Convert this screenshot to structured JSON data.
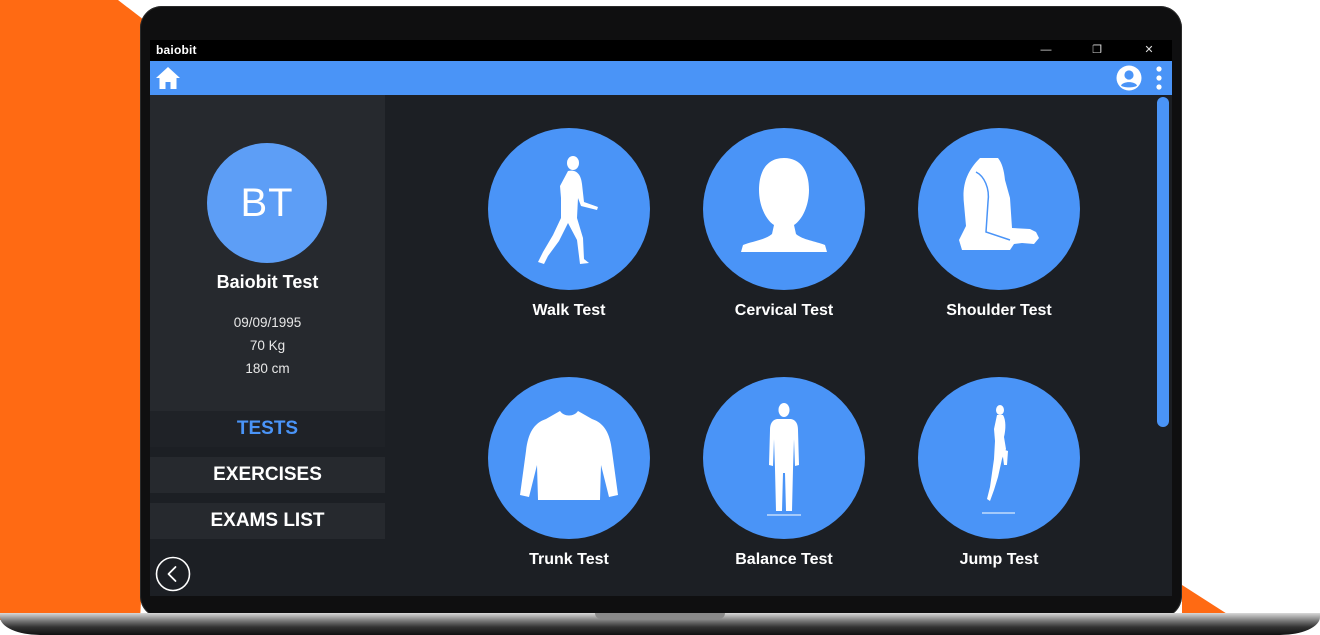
{
  "app": {
    "title": "baiobit"
  },
  "window_controls": {
    "minimize": "—",
    "maximize": "❐",
    "close": "✕"
  },
  "header": {
    "home_icon": "home-icon",
    "user_icon": "account-circle-icon",
    "menu_icon": "more-vert-icon"
  },
  "profile": {
    "initials": "BT",
    "name": "Baiobit Test",
    "birthdate": "09/09/1995",
    "weight": "70 Kg",
    "height": "180 cm"
  },
  "nav": {
    "items": [
      {
        "label": "TESTS",
        "active": true
      },
      {
        "label": "EXERCISES",
        "active": false
      },
      {
        "label": "EXAMS LIST",
        "active": false
      }
    ],
    "back_icon": "back-circle-icon"
  },
  "tests": [
    {
      "label": "Walk Test",
      "icon": "walking-figure-icon"
    },
    {
      "label": "Cervical Test",
      "icon": "head-bust-icon"
    },
    {
      "label": "Shoulder Test",
      "icon": "shoulder-icon"
    },
    {
      "label": "Trunk Test",
      "icon": "torso-icon"
    },
    {
      "label": "Balance Test",
      "icon": "standing-figure-icon"
    },
    {
      "label": "Jump Test",
      "icon": "jumping-figure-icon"
    }
  ],
  "colors": {
    "accent": "#4a94f7",
    "background": "#1c1f24",
    "sidebar_panel": "#26292e",
    "brand_orange": "#ff6a13"
  }
}
